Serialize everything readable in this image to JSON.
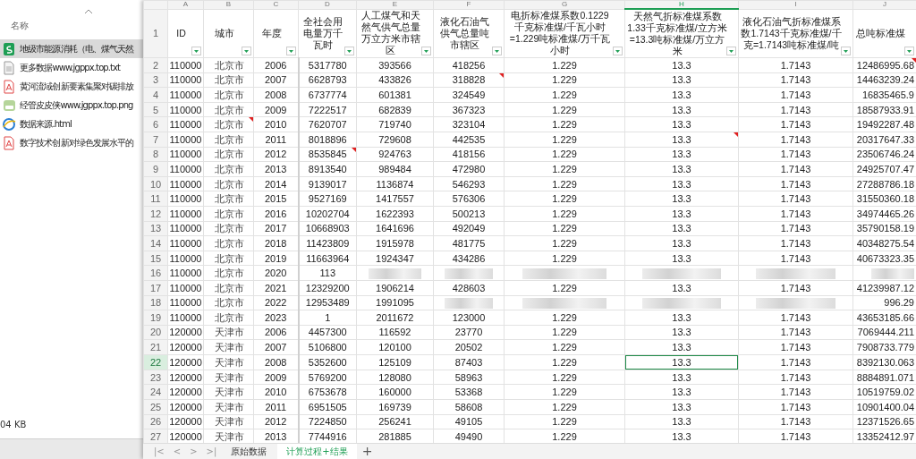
{
  "explorer": {
    "column_header": "名称",
    "files": [
      {
        "name": "地级市能源消耗（电、煤气天然",
        "kind": "sheet",
        "selected": true
      },
      {
        "name": "更多数据www.jgppx.top.txt",
        "kind": "text",
        "selected": false
      },
      {
        "name": "黄河流域创新要素集聚对碳排放",
        "kind": "pdf",
        "selected": false
      },
      {
        "name": "经管皮皮侠www.jgppx.top.png",
        "kind": "image",
        "selected": false
      },
      {
        "name": "数据来源.html",
        "kind": "web",
        "selected": false
      },
      {
        "name": "数字技术创新对绿色发展水平的",
        "kind": "pdf",
        "selected": false
      }
    ],
    "status": "04 KB"
  },
  "sheet": {
    "columns": [
      {
        "letter": "A",
        "header": "ID",
        "selected": false
      },
      {
        "letter": "B",
        "header": "城市",
        "selected": false
      },
      {
        "letter": "C",
        "header": "年度",
        "selected": false
      },
      {
        "letter": "D",
        "header": "全社会用电量万千瓦时",
        "selected": false
      },
      {
        "letter": "E",
        "header": "人工煤气和天然气供气总量万立方米市辖区",
        "selected": false
      },
      {
        "letter": "F",
        "header": "液化石油气供气总量吨市辖区",
        "selected": false
      },
      {
        "letter": "G",
        "header": "电折标准煤系数0.1229千克标准煤/千瓦小时=1.229吨标准煤/万千瓦小时",
        "selected": false
      },
      {
        "letter": "H",
        "header": "天然气折标准煤系数1.33千克标准煤/立方米=13.3吨标准煤/万立方米",
        "selected": true
      },
      {
        "letter": "I",
        "header": "液化石油气折标准煤系数1.7143千克标准煤/千克=1.7143吨标准煤/吨",
        "selected": false
      },
      {
        "letter": "J",
        "header": "总吨标准煤",
        "selected": false
      }
    ],
    "header_row": "1",
    "rows": [
      {
        "number": "2",
        "selected": false,
        "cells": [
          "110000",
          "北京市",
          "2006",
          "5317780",
          "393566",
          "418256",
          "1.229",
          "13.3",
          "1.7143",
          "12486995.68"
        ],
        "comments": [
          false,
          false,
          false,
          false,
          false,
          false,
          false,
          false,
          false,
          true
        ]
      },
      {
        "number": "3",
        "selected": false,
        "cells": [
          "110000",
          "北京市",
          "2007",
          "6628793",
          "433826",
          "318828",
          "1.229",
          "13.3",
          "1.7143",
          "14463239.24"
        ],
        "comments": [
          false,
          false,
          false,
          false,
          false,
          true,
          false,
          false,
          false,
          false
        ]
      },
      {
        "number": "4",
        "selected": false,
        "cells": [
          "110000",
          "北京市",
          "2008",
          "6737774",
          "601381",
          "324549",
          "1.229",
          "13.3",
          "1.7143",
          "16835465.9"
        ],
        "comments": [
          false,
          false,
          false,
          false,
          false,
          false,
          false,
          false,
          false,
          false
        ]
      },
      {
        "number": "5",
        "selected": false,
        "cells": [
          "110000",
          "北京市",
          "2009",
          "7222517",
          "682839",
          "367323",
          "1.229",
          "13.3",
          "1.7143",
          "18587933.91"
        ],
        "comments": [
          false,
          false,
          false,
          false,
          false,
          false,
          false,
          false,
          false,
          false
        ]
      },
      {
        "number": "6",
        "selected": false,
        "cells": [
          "110000",
          "北京市",
          "2010",
          "7620707",
          "719740",
          "323104",
          "1.229",
          "13.3",
          "1.7143",
          "19492287.48"
        ],
        "comments": [
          false,
          true,
          false,
          false,
          false,
          false,
          false,
          false,
          false,
          false
        ]
      },
      {
        "number": "7",
        "selected": false,
        "cells": [
          "110000",
          "北京市",
          "2011",
          "8018896",
          "729608",
          "442535",
          "1.229",
          "13.3",
          "1.7143",
          "20317647.33"
        ],
        "comments": [
          false,
          false,
          false,
          false,
          false,
          false,
          false,
          true,
          false,
          false
        ]
      },
      {
        "number": "8",
        "selected": false,
        "cells": [
          "110000",
          "北京市",
          "2012",
          "8535845",
          "924763",
          "418156",
          "1.229",
          "13.3",
          "1.7143",
          "23506746.24"
        ],
        "comments": [
          false,
          false,
          false,
          true,
          false,
          false,
          false,
          false,
          false,
          false
        ]
      },
      {
        "number": "9",
        "selected": false,
        "cells": [
          "110000",
          "北京市",
          "2013",
          "8913540",
          "989484",
          "472980",
          "1.229",
          "13.3",
          "1.7143",
          "24925707.47"
        ],
        "comments": [
          false,
          false,
          false,
          false,
          false,
          false,
          false,
          false,
          false,
          false
        ]
      },
      {
        "number": "10",
        "selected": false,
        "cells": [
          "110000",
          "北京市",
          "2014",
          "9139017",
          "1136874",
          "546293",
          "1.229",
          "13.3",
          "1.7143",
          "27288786.18"
        ],
        "comments": [
          false,
          false,
          false,
          false,
          false,
          false,
          false,
          false,
          false,
          false
        ]
      },
      {
        "number": "11",
        "selected": false,
        "cells": [
          "110000",
          "北京市",
          "2015",
          "9527169",
          "1417557",
          "576306",
          "1.229",
          "13.3",
          "1.7143",
          "31550360.18"
        ],
        "comments": [
          false,
          false,
          false,
          false,
          false,
          false,
          false,
          false,
          false,
          false
        ]
      },
      {
        "number": "12",
        "selected": false,
        "cells": [
          "110000",
          "北京市",
          "2016",
          "10202704",
          "1622393",
          "500213",
          "1.229",
          "13.3",
          "1.7143",
          "34974465.26"
        ],
        "comments": [
          false,
          false,
          false,
          false,
          false,
          false,
          false,
          false,
          false,
          false
        ]
      },
      {
        "number": "13",
        "selected": false,
        "cells": [
          "110000",
          "北京市",
          "2017",
          "10668903",
          "1641696",
          "492049",
          "1.229",
          "13.3",
          "1.7143",
          "35790158.19"
        ],
        "comments": [
          false,
          false,
          false,
          false,
          false,
          false,
          false,
          false,
          false,
          false
        ]
      },
      {
        "number": "14",
        "selected": false,
        "cells": [
          "110000",
          "北京市",
          "2018",
          "11423809",
          "1915978",
          "481775",
          "1.229",
          "13.3",
          "1.7143",
          "40348275.54"
        ],
        "comments": [
          false,
          false,
          false,
          false,
          false,
          false,
          false,
          false,
          false,
          false
        ]
      },
      {
        "number": "15",
        "selected": false,
        "cells": [
          "110000",
          "北京市",
          "2019",
          "11663964",
          "1924347",
          "434286",
          "1.229",
          "13.3",
          "1.7143",
          "40673323.35"
        ],
        "comments": [
          false,
          false,
          false,
          false,
          false,
          false,
          false,
          false,
          false,
          false
        ]
      },
      {
        "number": "16",
        "selected": false,
        "cells": [
          "110000",
          "北京市",
          "2020",
          "113",
          null,
          null,
          null,
          null,
          null,
          null
        ],
        "comments": [
          false,
          false,
          false,
          false,
          false,
          false,
          false,
          false,
          false,
          false
        ]
      },
      {
        "number": "17",
        "selected": false,
        "cells": [
          "110000",
          "北京市",
          "2021",
          "12329200",
          "1906214",
          "428603",
          "1.229",
          "13.3",
          "1.7143",
          "41239987.12"
        ],
        "comments": [
          false,
          false,
          false,
          false,
          false,
          false,
          false,
          false,
          false,
          false
        ]
      },
      {
        "number": "18",
        "selected": false,
        "cells": [
          "110000",
          "北京市",
          "2022",
          "12953489",
          "1991095",
          null,
          null,
          null,
          null,
          "996.29"
        ],
        "comments": [
          false,
          false,
          false,
          false,
          false,
          false,
          false,
          false,
          false,
          false
        ]
      },
      {
        "number": "19",
        "selected": false,
        "cells": [
          "110000",
          "北京市",
          "2023",
          "1",
          "2011672",
          "123000",
          "1.229",
          "13.3",
          "1.7143",
          "43653185.66"
        ],
        "comments": [
          false,
          false,
          false,
          false,
          false,
          false,
          false,
          false,
          false,
          false
        ]
      },
      {
        "number": "20",
        "selected": false,
        "cells": [
          "120000",
          "天津市",
          "2006",
          "4457300",
          "116592",
          "23770",
          "1.229",
          "13.3",
          "1.7143",
          "7069444.211"
        ],
        "comments": [
          false,
          false,
          false,
          false,
          false,
          false,
          false,
          false,
          false,
          false
        ]
      },
      {
        "number": "21",
        "selected": false,
        "cells": [
          "120000",
          "天津市",
          "2007",
          "5106800",
          "120100",
          "20502",
          "1.229",
          "13.3",
          "1.7143",
          "7908733.779"
        ],
        "comments": [
          false,
          false,
          false,
          false,
          false,
          false,
          false,
          false,
          false,
          false
        ]
      },
      {
        "number": "22",
        "selected": true,
        "cells": [
          "120000",
          "天津市",
          "2008",
          "5352600",
          "125109",
          "87403",
          "1.229",
          "13.3",
          "1.7143",
          "8392130.063"
        ],
        "comments": [
          false,
          false,
          false,
          false,
          false,
          false,
          false,
          false,
          false,
          false
        ]
      },
      {
        "number": "23",
        "selected": false,
        "cells": [
          "120000",
          "天津市",
          "2009",
          "5769200",
          "128080",
          "58963",
          "1.229",
          "13.3",
          "1.7143",
          "8884891.071"
        ],
        "comments": [
          false,
          false,
          false,
          false,
          false,
          false,
          false,
          false,
          false,
          false
        ]
      },
      {
        "number": "24",
        "selected": false,
        "cells": [
          "120000",
          "天津市",
          "2010",
          "6753678",
          "160000",
          "53368",
          "1.229",
          "13.3",
          "1.7143",
          "10519759.02"
        ],
        "comments": [
          false,
          false,
          false,
          false,
          false,
          false,
          false,
          false,
          false,
          false
        ]
      },
      {
        "number": "25",
        "selected": false,
        "cells": [
          "120000",
          "天津市",
          "2011",
          "6951505",
          "169739",
          "58608",
          "1.229",
          "13.3",
          "1.7143",
          "10901400.04"
        ],
        "comments": [
          false,
          false,
          false,
          false,
          false,
          false,
          false,
          false,
          false,
          false
        ]
      },
      {
        "number": "26",
        "selected": false,
        "cells": [
          "120000",
          "天津市",
          "2012",
          "7224850",
          "256241",
          "49105",
          "1.229",
          "13.3",
          "1.7143",
          "12371526.65"
        ],
        "comments": [
          false,
          false,
          false,
          false,
          false,
          false,
          false,
          false,
          false,
          false
        ]
      },
      {
        "number": "27",
        "selected": false,
        "cells": [
          "120000",
          "天津市",
          "2013",
          "7744916",
          "281885",
          "49490",
          "1.229",
          "13.3",
          "1.7143",
          "13352412.97"
        ],
        "comments": [
          false,
          false,
          false,
          false,
          false,
          false,
          false,
          false,
          false,
          false
        ]
      }
    ]
  },
  "sheet_tabs": {
    "nav": [
      "|<",
      "<",
      ">",
      ">|"
    ],
    "tabs": [
      {
        "label": "原始数据",
        "selected": false
      },
      {
        "label": "计算过程+结果",
        "selected": true
      }
    ],
    "add": "+"
  }
}
